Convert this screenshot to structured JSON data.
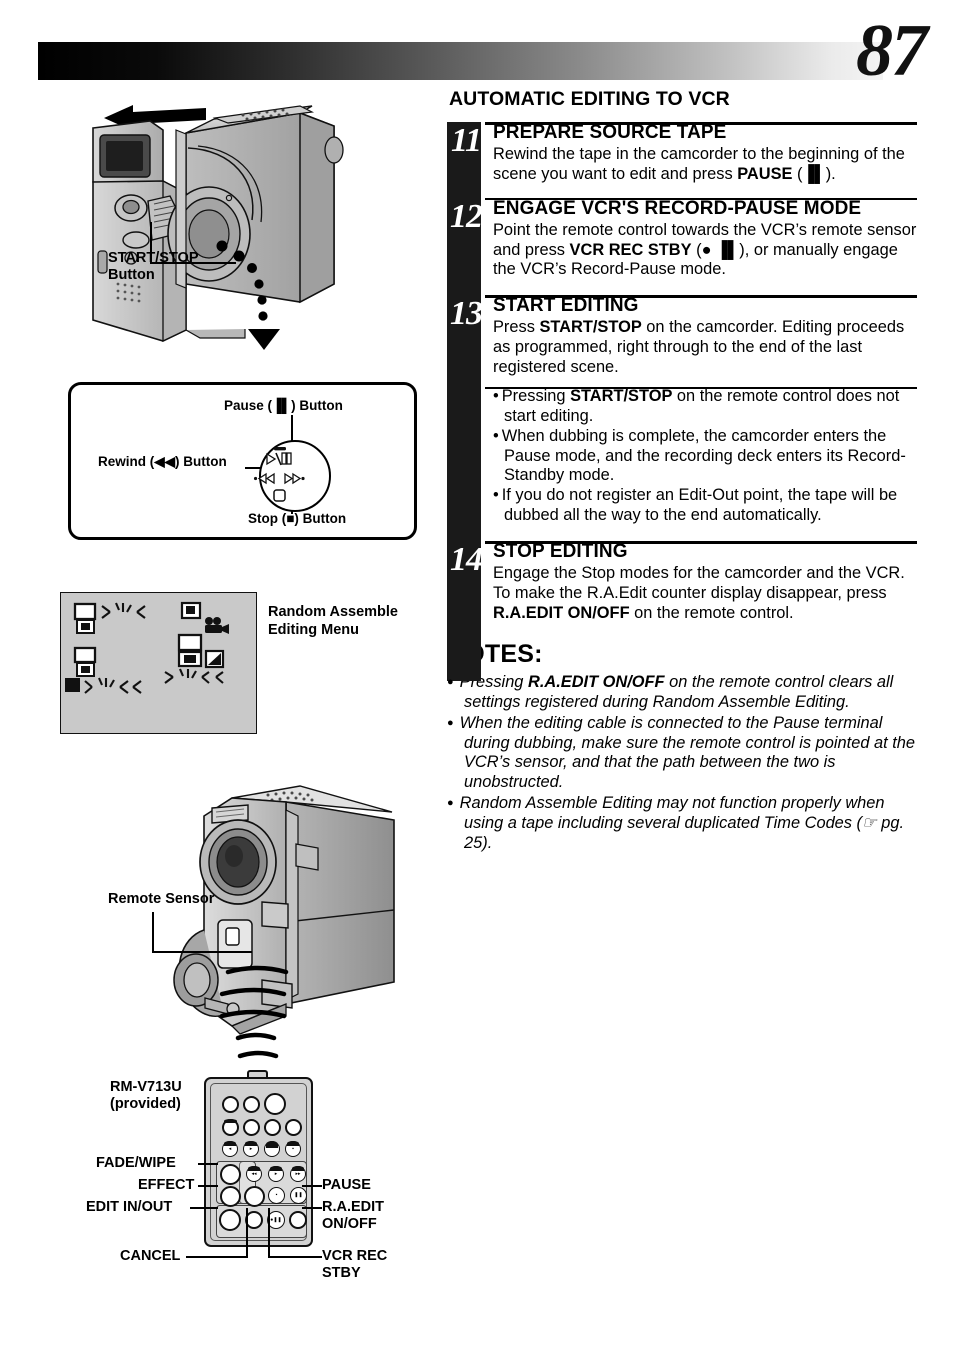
{
  "page": {
    "number": "87"
  },
  "section": {
    "title": "AUTOMATIC EDITING TO VCR"
  },
  "steps": [
    {
      "number": "11",
      "heading": "PREPARE SOURCE TAPE",
      "body_parts": [
        {
          "t": "Rewind the tape in the camcorder to the beginning of the scene you want to edit and press ",
          "b": false
        },
        {
          "t": "PAUSE",
          "b": true
        },
        {
          "t": " (▐▌).",
          "b": false
        }
      ]
    },
    {
      "number": "12",
      "heading": "ENGAGE VCR'S RECORD-PAUSE MODE",
      "body_parts": [
        {
          "t": "Point the remote control towards the VCR’s remote sensor and press ",
          "b": false
        },
        {
          "t": "VCR REC STBY",
          "b": true
        },
        {
          "t": " (● ▐▌), or manually engage the VCR’s Record-Pause mode.",
          "b": false
        }
      ]
    },
    {
      "number": "13",
      "heading": "START EDITING",
      "body_parts": [
        {
          "t": "Press ",
          "b": false
        },
        {
          "t": "START/STOP",
          "b": true
        },
        {
          "t": " on the camcorder. Editing proceeds as programmed, right through to the end of the last registered scene.",
          "b": false
        }
      ],
      "bullets": [
        [
          {
            "t": "Pressing ",
            "b": false
          },
          {
            "t": "START/STOP",
            "b": true
          },
          {
            "t": " on the remote control does not start editing.",
            "b": false
          }
        ],
        [
          {
            "t": "When dubbing is complete, the camcorder enters the Pause mode, and the recording deck enters its Record-Standby mode.",
            "b": false
          }
        ],
        [
          {
            "t": "If you do not register an Edit-Out point, the tape will be dubbed all the way to the end automatically.",
            "b": false
          }
        ]
      ]
    },
    {
      "number": "14",
      "heading": "STOP EDITING",
      "body_parts": [
        {
          "t": "Engage the Stop modes for the camcorder and the VCR.\nTo make the R.A.Edit counter display disappear, press ",
          "b": false
        },
        {
          "t": "R.A.EDIT ON/OFF",
          "b": true
        },
        {
          "t": " on the remote control.",
          "b": false
        }
      ]
    }
  ],
  "notes": {
    "title": "NOTES:",
    "items": [
      [
        {
          "t": "Pressing ",
          "b": false
        },
        {
          "t": "R.A.EDIT ON/OFF",
          "b": true
        },
        {
          "t": " on the remote control clears all settings registered during Random Assemble Editing.",
          "b": false
        }
      ],
      [
        {
          "t": "When the editing cable is connected to the Pause terminal during dubbing, make sure the remote control is pointed at the VCR’s sensor, and that the path between the two is unobstructed.",
          "b": false
        }
      ],
      [
        {
          "t": "Random Assemble Editing may not function properly when using a tape including several duplicated Time Codes (☞ pg. 25).",
          "b": false
        }
      ]
    ]
  },
  "figures": {
    "camcorder_top": {
      "callout": "START/STOP\nButton"
    },
    "button_box": {
      "pause_label": "Pause (▐▌) Button",
      "rewind_label": "Rewind (◀◀) Button",
      "stop_label": "Stop (■) Button"
    },
    "menu_screen": {
      "label": "Random Assemble\nEditing Menu"
    },
    "camcorder_bottom": {
      "callout": "Remote Sensor"
    },
    "remote": {
      "model": "RM-V713U\n(provided)",
      "labels_left": [
        "FADE/WIPE",
        "EFFECT",
        "EDIT IN/OUT",
        "CANCEL"
      ],
      "labels_right": [
        "PAUSE",
        "R.A.EDIT\nON/OFF",
        "VCR REC\nSTBY"
      ]
    }
  },
  "colors": {
    "ink": "#000000",
    "sidebar": "#1a1a1a",
    "screen_gray": "#c9c9c9",
    "remote_gray": "#d2d2d2"
  }
}
